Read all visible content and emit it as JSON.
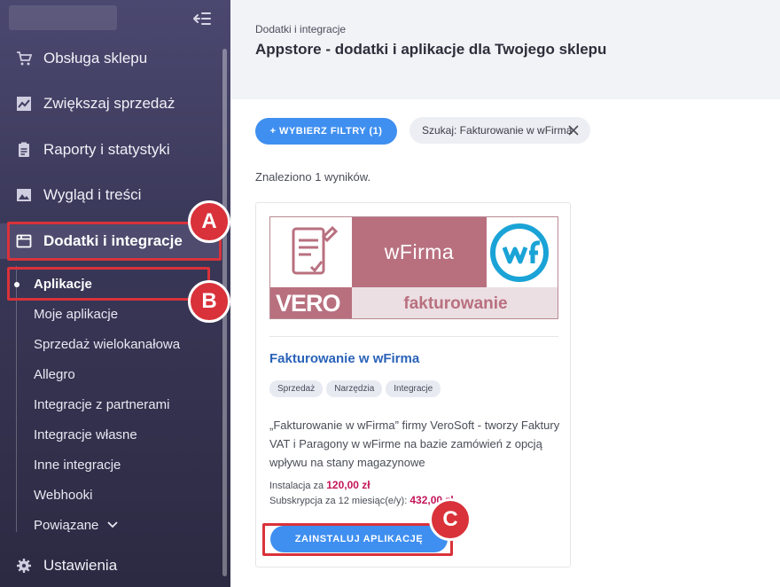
{
  "sidebar": {
    "items": [
      {
        "label": "Obsługa sklepu",
        "icon": "cart-icon"
      },
      {
        "label": "Zwiększaj sprzedaż",
        "icon": "chart-icon"
      },
      {
        "label": "Raporty i statystyki",
        "icon": "clipboard-icon"
      },
      {
        "label": "Wygląd i treści",
        "icon": "image-icon"
      },
      {
        "label": "Dodatki i integracje",
        "icon": "window-icon",
        "active": true
      }
    ],
    "subitems": [
      {
        "label": "Aplikacje",
        "active": true
      },
      {
        "label": "Moje aplikacje"
      },
      {
        "label": "Sprzedaż wielokanałowa"
      },
      {
        "label": "Allegro"
      },
      {
        "label": "Integracje z partnerami"
      },
      {
        "label": "Integracje własne"
      },
      {
        "label": "Inne integracje"
      },
      {
        "label": "Webhooki"
      },
      {
        "label": "Powiązane"
      }
    ],
    "settings": {
      "label": "Ustawienia",
      "icon": "gear-icon"
    }
  },
  "header": {
    "breadcrumb": "Dodatki i integracje",
    "title": "Appstore - dodatki i aplikacje dla Twojego sklepu"
  },
  "filters": {
    "button_label": "+ WYBIERZ FILTRY (1)",
    "search_chip": "Szukaj: Fakturowanie w wFirma"
  },
  "results_text": "Znaleziono 1 wyników.",
  "card": {
    "banner": {
      "brand": "wFirma",
      "tagline": "fakturowanie",
      "vendor_mark": "VERO"
    },
    "title": "Fakturowanie w wFirma",
    "tags": [
      "Sprzedaż",
      "Narzędzia",
      "Integracje"
    ],
    "description": "„Fakturowanie w wFirma” firmy VeroSoft - tworzy Faktury VAT i Paragony w wFirme na bazie zamówień z opcją wpływu na stany magazynowe",
    "install_label": "Instalacja za",
    "install_price": "120,00 zł",
    "subscription_label": "Subskrypcja za 12 miesiąc(e/y):",
    "subscription_price": "432,00 zł",
    "install_button": "ZAINSTALUJ APLIKACJĘ"
  },
  "annotations": [
    "A",
    "B",
    "C"
  ],
  "colors": {
    "accent": "#3f8ff0",
    "highlight": "#d9323a",
    "price": "#c4165a",
    "brand": "#b8707f"
  }
}
